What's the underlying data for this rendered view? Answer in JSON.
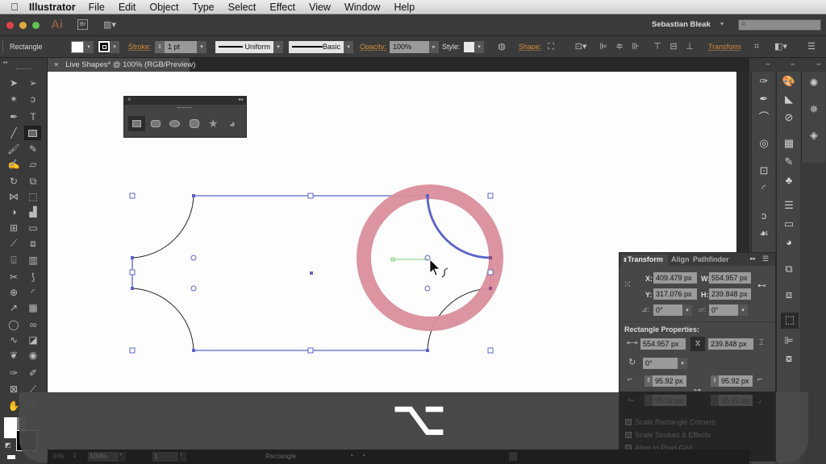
{
  "menubar": {
    "apple_icon": "",
    "app_name": "Illustrator",
    "items": [
      "File",
      "Edit",
      "Object",
      "Type",
      "Select",
      "Effect",
      "View",
      "Window",
      "Help"
    ]
  },
  "appbar": {
    "logo": "Ai",
    "bridge_label": "Br",
    "user_name": "Sebastian Bleak",
    "user_menu_arrow": "▾",
    "search_placeholder": ""
  },
  "control_bar": {
    "tool_name": "Rectangle",
    "stroke_label": "Stroke:",
    "stroke_weight": "1 pt",
    "profile_label": "Uniform",
    "brush_label": "Basic",
    "opacity_label": "Opacity:",
    "opacity_value": "100%",
    "style_label": "Style:",
    "shape_label": "Shape:",
    "transform_label": "Transform"
  },
  "document_tab": {
    "close": "×",
    "title": "Live Shapes* @ 100% (RGB/Preview)"
  },
  "shapes_panel": {
    "close": "×",
    "collapse": "◂◂",
    "tools": [
      "rectangle",
      "rounded-rectangle",
      "ellipse",
      "polygon",
      "star",
      "flare"
    ]
  },
  "transform_panel": {
    "tabs": [
      "Transform",
      "Align",
      "Pathfinder"
    ],
    "x_label": "X:",
    "x_value": "409.479 px",
    "y_label": "Y:",
    "y_value": "317.076 px",
    "w_label": "W:",
    "w_value": "554.957 px",
    "h_label": "H:",
    "h_value": "239.848 px",
    "rotate_value": "0°",
    "shear_value": "0°",
    "section_title": "Rectangle Properties:",
    "rect_width": "554.957 px",
    "rect_height": "239.848 px",
    "rect_rotate": "0°",
    "corner_tl": "95.92 px",
    "corner_tr": "95.92 px",
    "corner_bl": "95.92 px",
    "corner_br": "95.92 px",
    "options": [
      "Scale Rectangle Corners",
      "Scale Strokes & Effects",
      "Align to Pixel Grid"
    ]
  },
  "overlay": {
    "key_glyph": "⌥"
  },
  "status_bar": {
    "zoom": "100%",
    "artboard": "1",
    "current_tool": "Rectangle"
  },
  "colors": {
    "selection": "#5964c8",
    "highlight_ring": "#d98e9b",
    "accent_orange": "#d38b3c",
    "guide_green": "#7ed07e"
  }
}
